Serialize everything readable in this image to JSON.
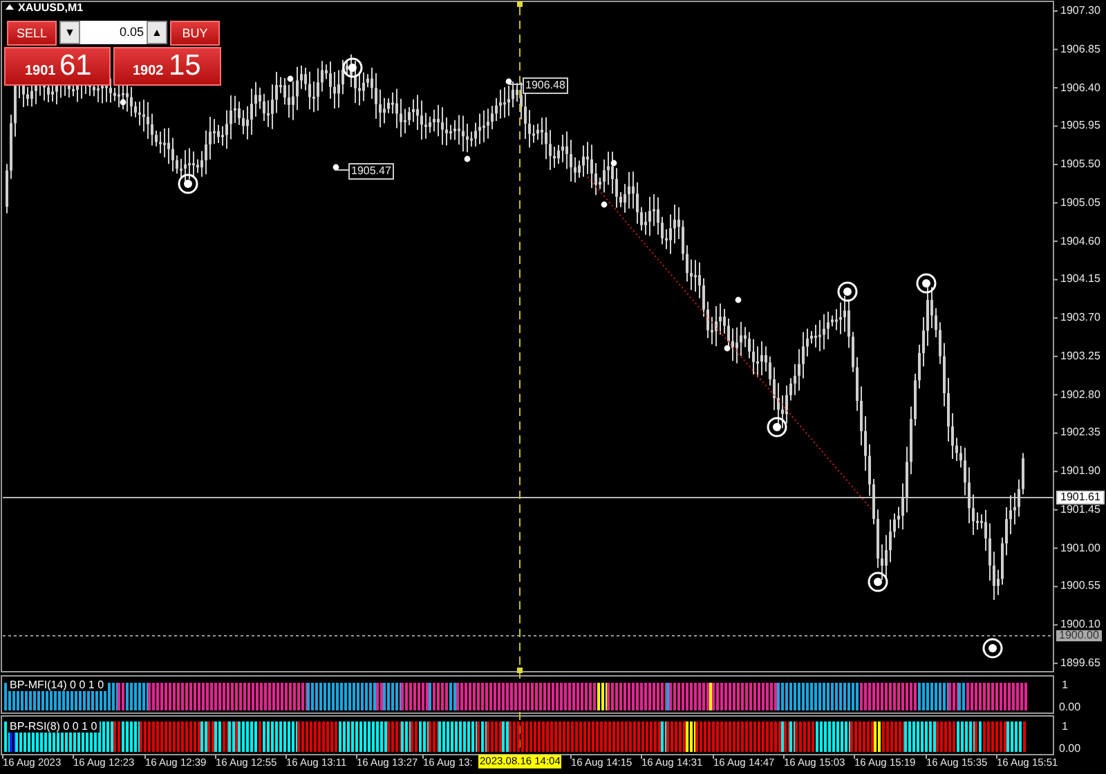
{
  "chart": {
    "symbol": "XAUUSD,M1"
  },
  "trade_panel": {
    "sell_label": "SELL",
    "lot_down": "▼",
    "lot": "0.05",
    "lot_up": "▲",
    "buy_label": "BUY",
    "sell_main": "1901",
    "sell_pips": "61",
    "buy_main": "1902",
    "buy_pips": "15"
  },
  "price_axis": [
    "1907.30",
    "1906.85",
    "1906.40",
    "1905.95",
    "1905.50",
    "1905.05",
    "1904.60",
    "1904.15",
    "1903.70",
    "1903.25",
    "1902.80",
    "1902.35",
    "1901.90",
    "1901.45",
    "1901.00",
    "1900.55",
    "1900.10",
    "1899.65"
  ],
  "current_price": "1901.61",
  "level_price": "1900.00",
  "price_labels": [
    "1906.48",
    "1905.47"
  ],
  "indicators": [
    {
      "name": "BP-MFI(14) 0 0 1 0",
      "axis": [
        "1",
        "0.00"
      ]
    },
    {
      "name": "BP-RSI(8) 0 0 1 0",
      "axis": [
        "1",
        "0.00"
      ]
    }
  ],
  "time_axis": [
    "16 Aug 2023",
    "16 Aug 12:23",
    "16 Aug 12:39",
    "16 Aug 12:55",
    "16 Aug 13:11",
    "16 Aug 13:27",
    "16 Aug 13:",
    "16 Aug 14:15",
    "16 Aug 14:31",
    "16 Aug 14:47",
    "16 Aug 15:03",
    "16 Aug 15:19",
    "16 Aug 15:35",
    "16 Aug 15:51"
  ],
  "cursor_time": "2023.08.16 14:04"
}
